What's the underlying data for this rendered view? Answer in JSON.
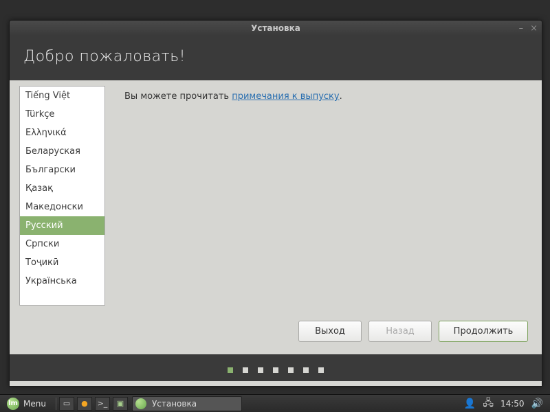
{
  "window": {
    "title": "Установка",
    "welcome": "Добро пожаловать!"
  },
  "hint": {
    "prefix": "Вы можете прочитать ",
    "link": "примечания к выпуску",
    "suffix": "."
  },
  "languages": [
    {
      "label": "Tiếng Việt",
      "selected": false
    },
    {
      "label": "Türkçe",
      "selected": false
    },
    {
      "label": "Ελληνικά",
      "selected": false
    },
    {
      "label": "Беларуская",
      "selected": false
    },
    {
      "label": "Български",
      "selected": false
    },
    {
      "label": "Қазақ",
      "selected": false
    },
    {
      "label": "Македонски",
      "selected": false
    },
    {
      "label": "Русский",
      "selected": true
    },
    {
      "label": "Српски",
      "selected": false
    },
    {
      "label": "Тоҷикӣ",
      "selected": false
    },
    {
      "label": "Українська",
      "selected": false
    }
  ],
  "buttons": {
    "quit": "Выход",
    "back": "Назад",
    "continue": "Продолжить"
  },
  "progress": {
    "current": 0,
    "total": 7
  },
  "panel": {
    "menu": "Menu",
    "task": "Установка",
    "clock": "14:50"
  }
}
